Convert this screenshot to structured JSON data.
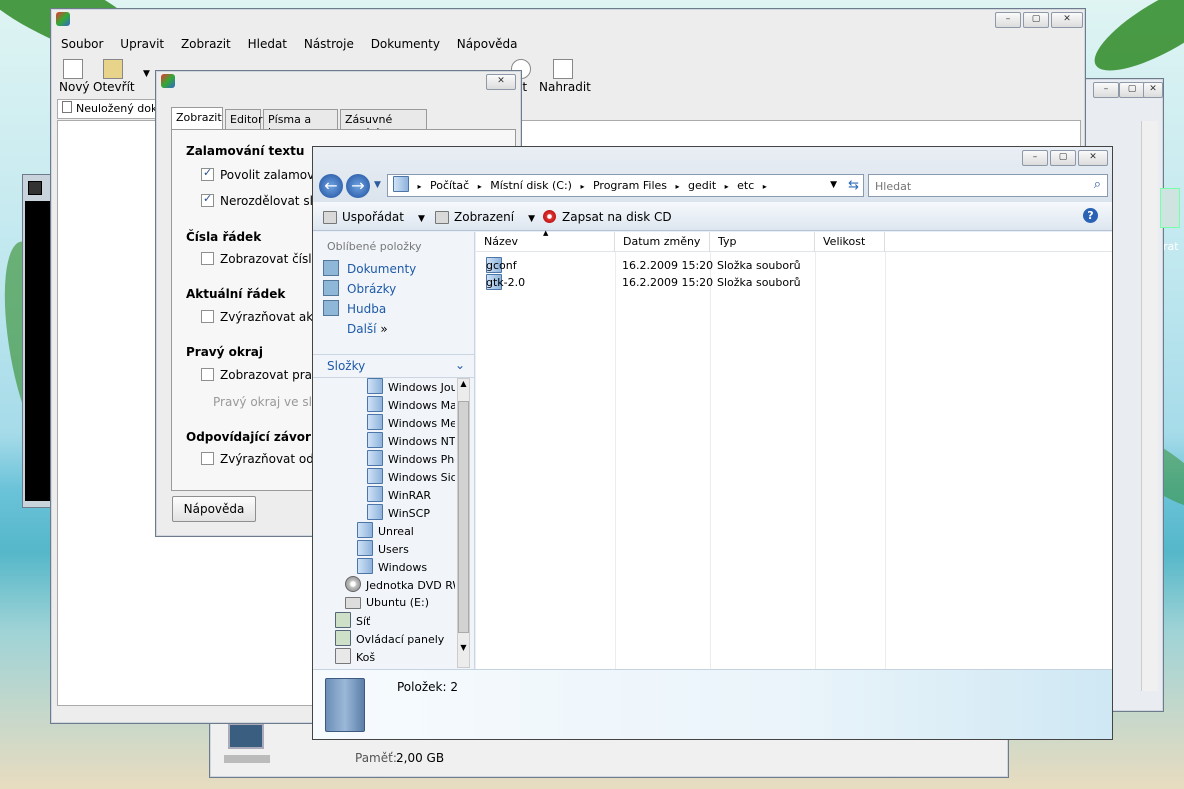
{
  "gedit": {
    "menu": [
      "Soubor",
      "Upravit",
      "Zobrazit",
      "Hledat",
      "Nástroje",
      "Dokumenty",
      "Nápověda"
    ],
    "toolbar": {
      "new": "Nový",
      "open": "Otevřít",
      "search_partial": "at",
      "replace": "Nahradit"
    },
    "doc_tab": "Neuložený dokum"
  },
  "prefs": {
    "tabs": [
      "Zobrazit",
      "Editor",
      "Písma a barvy",
      "Zásuvné moduly"
    ],
    "sections": {
      "wrap": "Zalamování textu",
      "wrap_enable": "Povolit zalamování t",
      "wrap_nosplit": "Nerozdělovat slova",
      "line_numbers": "Čísla řádek",
      "line_numbers_show": "Zobrazovat čísla řá",
      "current_line": "Aktuální řádek",
      "current_line_hl": "Zvýrazňovat aktuál",
      "right_margin": "Pravý okraj",
      "right_margin_show": "Zobrazovat pravý o",
      "right_margin_col": "Pravý okraj ve sloupci:",
      "brackets": "Odpovídající závorky",
      "brackets_hl": "Zvýrazňovat odpov"
    },
    "help": "Nápověda"
  },
  "explorer": {
    "breadcrumb": [
      "Počítač",
      "Místní disk (C:)",
      "Program Files",
      "gedit",
      "etc"
    ],
    "search_placeholder": "Hledat",
    "cmd": {
      "organize": "Uspořádat",
      "views": "Zobrazení",
      "burn": "Zapsat na disk CD"
    },
    "favorites_title": "Oblíbené položky",
    "favorites": [
      "Dokumenty",
      "Obrázky",
      "Hudba"
    ],
    "more": "Další",
    "folders_title": "Složky",
    "tree": [
      "Windows Journ",
      "Windows Mail",
      "Windows Media",
      "Windows NT",
      "Windows Photo",
      "Windows Sideb",
      "WinRAR",
      "WinSCP",
      "Unreal",
      "Users",
      "Windows",
      "Jednotka DVD RW",
      "Ubuntu (E:)",
      "Síť",
      "Ovládací panely",
      "Koš"
    ],
    "columns": [
      "Název",
      "Datum změny",
      "Typ",
      "Velikost"
    ],
    "files": [
      {
        "name": "gconf",
        "date": "16.2.2009 15:20",
        "type": "Složka souborů"
      },
      {
        "name": "gtk-2.0",
        "date": "16.2.2009 15:20",
        "type": "Složka souborů"
      }
    ],
    "status": "Položek: 2"
  },
  "sysinfo": {
    "memory_label": "Paměť:",
    "memory_value": "2,00 GB"
  },
  "right_partial": "rat"
}
